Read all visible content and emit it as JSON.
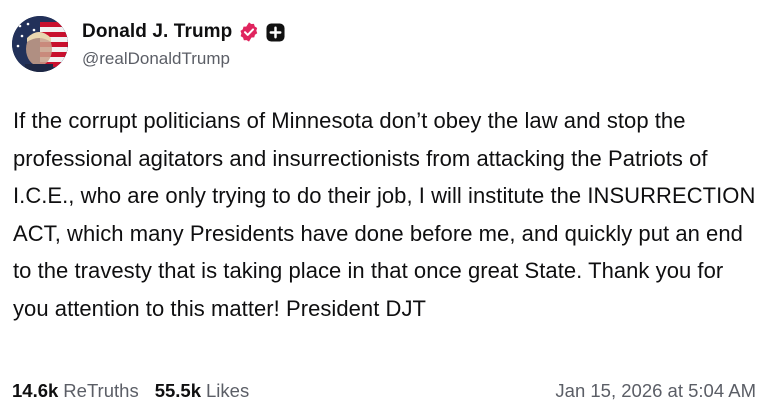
{
  "author": {
    "display_name": "Donald J. Trump",
    "handle": "@realDonaldTrump",
    "verified_icon": "verified-badge-icon",
    "plus_icon": "plus-badge-icon",
    "badge_color": "#e0245e"
  },
  "post": {
    "text": "If the corrupt politicians of Minnesota don’t obey the law and stop the professional agitators and insurrectionists from attacking the Patriots of I.C.E., who are only trying to do their job, I will institute the INSURRECTION ACT, which many Presidents have done before me, and quickly put an end to the travesty that is taking place in that once great State. Thank you for you attention to this matter! President DJT"
  },
  "stats": {
    "retruths_count": "14.6k",
    "retruths_label": "ReTruths",
    "likes_count": "55.5k",
    "likes_label": "Likes"
  },
  "timestamp": "Jan 15, 2026 at 5:04 AM"
}
